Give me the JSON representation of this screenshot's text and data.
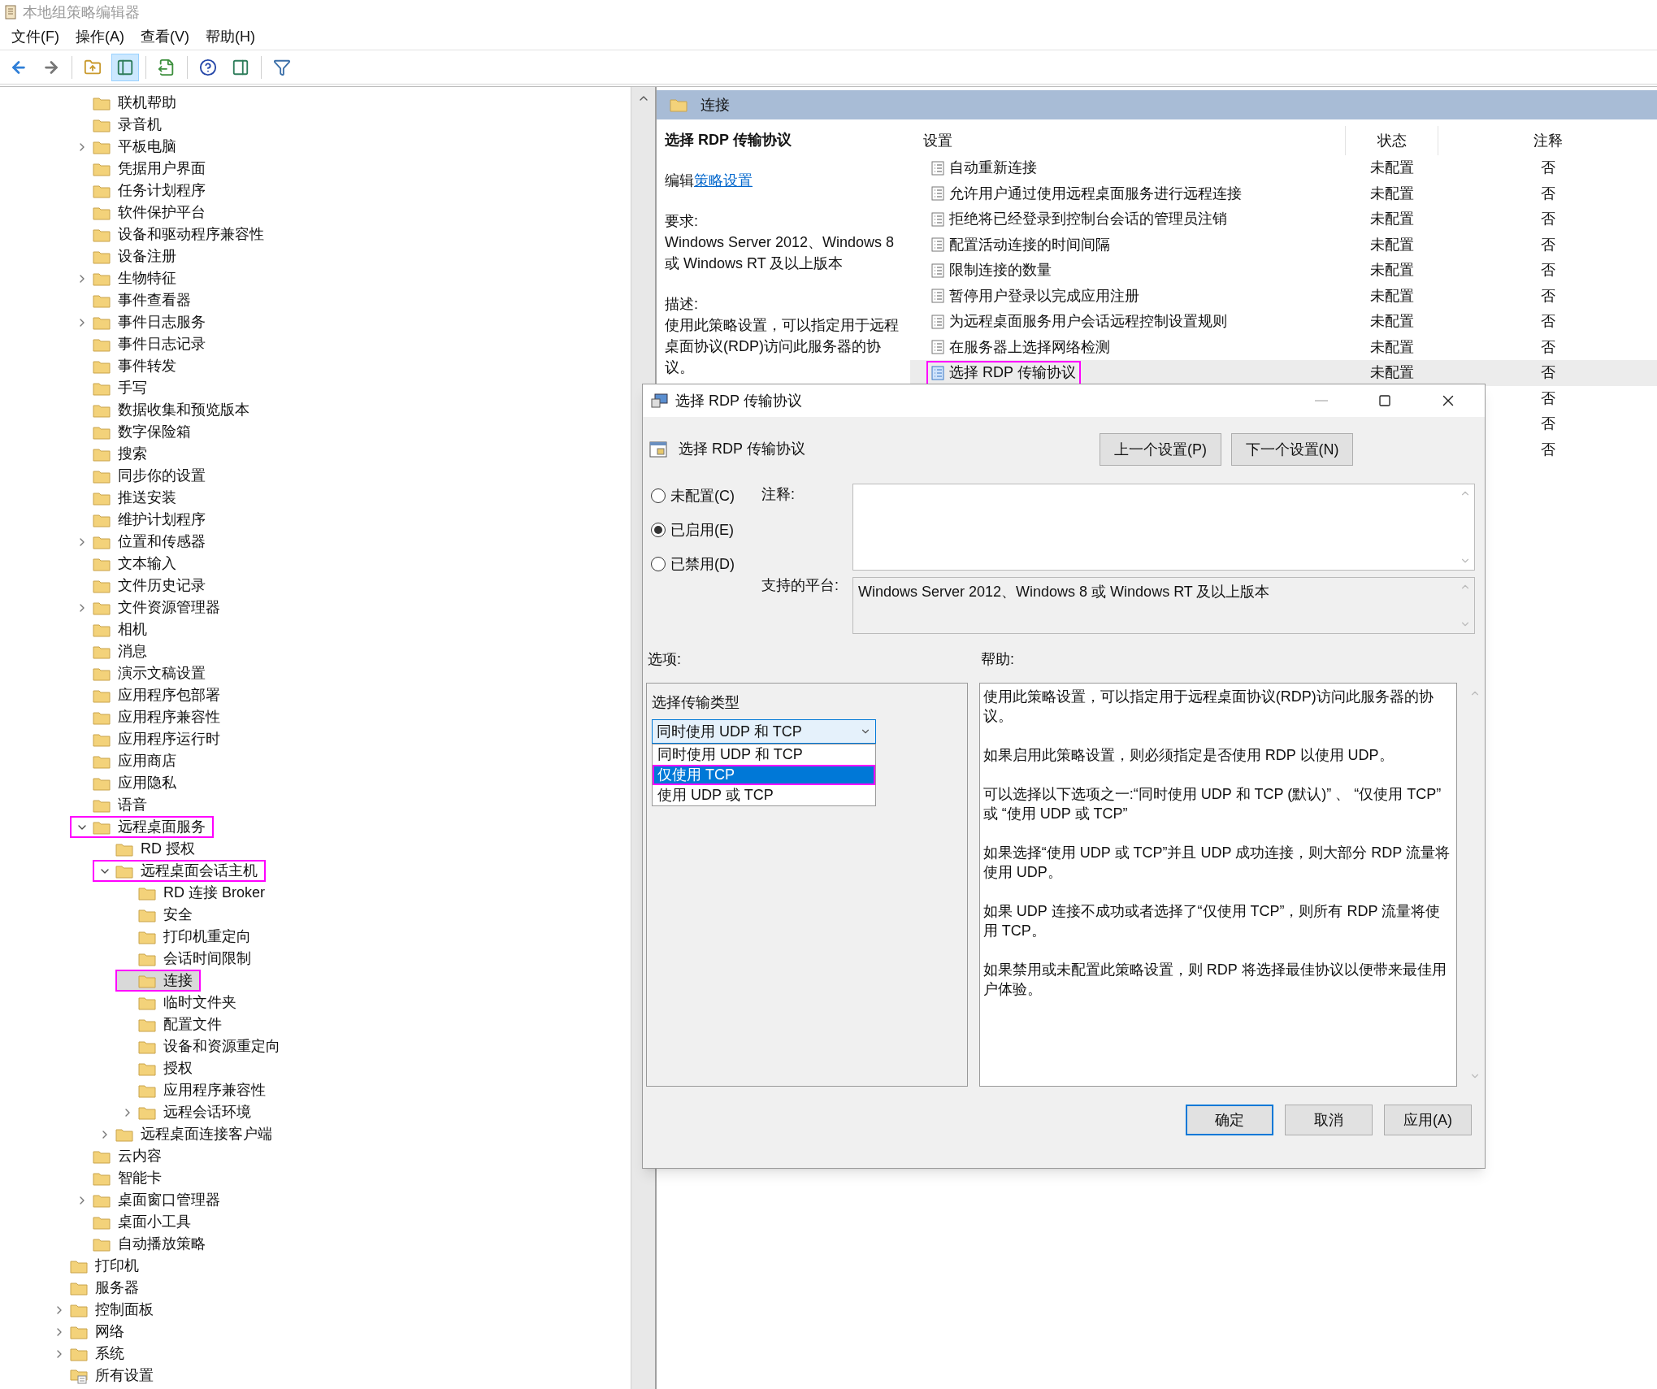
{
  "window": {
    "title": "本地组策略编辑器"
  },
  "menu": [
    "文件(F)",
    "操作(A)",
    "查看(V)",
    "帮助(H)"
  ],
  "toolbar": [
    {
      "kind": "back",
      "pressed": false
    },
    {
      "kind": "forward",
      "pressed": false
    },
    {
      "kind": "up",
      "pressed": false
    },
    {
      "kind": "tree",
      "pressed": true
    },
    {
      "kind": "export",
      "pressed": false
    },
    {
      "kind": "help",
      "pressed": false
    },
    {
      "kind": "actions",
      "pressed": false
    },
    {
      "kind": "filter",
      "pressed": false
    }
  ],
  "tree": {
    "nested_items": [
      {
        "label": "联机帮助",
        "expandable": false,
        "selected": false,
        "annotated": false
      },
      {
        "label": "录音机",
        "expandable": false,
        "selected": false,
        "annotated": false
      },
      {
        "label": "平板电脑",
        "expandable": true,
        "expanded": false,
        "selected": false,
        "annotated": false
      },
      {
        "label": "凭据用户界面",
        "expandable": false,
        "selected": false,
        "annotated": false
      },
      {
        "label": "任务计划程序",
        "expandable": false,
        "selected": false,
        "annotated": false
      },
      {
        "label": "软件保护平台",
        "expandable": false,
        "selected": false,
        "annotated": false
      },
      {
        "label": "设备和驱动程序兼容性",
        "expandable": false,
        "selected": false,
        "annotated": false
      },
      {
        "label": "设备注册",
        "expandable": false,
        "selected": false,
        "annotated": false
      },
      {
        "label": "生物特征",
        "expandable": true,
        "expanded": false,
        "selected": false,
        "annotated": false
      },
      {
        "label": "事件查看器",
        "expandable": false,
        "selected": false,
        "annotated": false
      },
      {
        "label": "事件日志服务",
        "expandable": true,
        "expanded": false,
        "selected": false,
        "annotated": false
      },
      {
        "label": "事件日志记录",
        "expandable": false,
        "selected": false,
        "annotated": false
      },
      {
        "label": "事件转发",
        "expandable": false,
        "selected": false,
        "annotated": false
      },
      {
        "label": "手写",
        "expandable": false,
        "selected": false,
        "annotated": false
      },
      {
        "label": "数据收集和预览版本",
        "expandable": false,
        "selected": false,
        "annotated": false
      },
      {
        "label": "数字保险箱",
        "expandable": false,
        "selected": false,
        "annotated": false
      },
      {
        "label": "搜索",
        "expandable": false,
        "selected": false,
        "annotated": false
      },
      {
        "label": "同步你的设置",
        "expandable": false,
        "selected": false,
        "annotated": false
      },
      {
        "label": "推送安装",
        "expandable": false,
        "selected": false,
        "annotated": false
      },
      {
        "label": "维护计划程序",
        "expandable": false,
        "selected": false,
        "annotated": false
      },
      {
        "label": "位置和传感器",
        "expandable": true,
        "expanded": false,
        "selected": false,
        "annotated": false
      },
      {
        "label": "文本输入",
        "expandable": false,
        "selected": false,
        "annotated": false
      },
      {
        "label": "文件历史记录",
        "expandable": false,
        "selected": false,
        "annotated": false
      },
      {
        "label": "文件资源管理器",
        "expandable": true,
        "expanded": false,
        "selected": false,
        "annotated": false
      },
      {
        "label": "相机",
        "expandable": false,
        "selected": false,
        "annotated": false
      },
      {
        "label": "消息",
        "expandable": false,
        "selected": false,
        "annotated": false
      },
      {
        "label": "演示文稿设置",
        "expandable": false,
        "selected": false,
        "annotated": false
      },
      {
        "label": "应用程序包部署",
        "expandable": false,
        "selected": false,
        "annotated": false
      },
      {
        "label": "应用程序兼容性",
        "expandable": false,
        "selected": false,
        "annotated": false
      },
      {
        "label": "应用程序运行时",
        "expandable": false,
        "selected": false,
        "annotated": false
      },
      {
        "label": "应用商店",
        "expandable": false,
        "selected": false,
        "annotated": false
      },
      {
        "label": "应用隐私",
        "expandable": false,
        "selected": false,
        "annotated": false
      },
      {
        "label": "语音",
        "expandable": false,
        "selected": false,
        "annotated": false
      },
      {
        "label": "远程桌面服务",
        "expandable": true,
        "expanded": true,
        "selected": false,
        "annotated": true,
        "children": [
          {
            "label": "RD 授权",
            "expandable": false,
            "selected": false,
            "annotated": false
          },
          {
            "label": "远程桌面会话主机",
            "expandable": true,
            "expanded": true,
            "selected": false,
            "annotated": true,
            "children": [
              {
                "label": "RD 连接 Broker",
                "expandable": false,
                "selected": false,
                "annotated": false
              },
              {
                "label": "安全",
                "expandable": false,
                "selected": false,
                "annotated": false
              },
              {
                "label": "打印机重定向",
                "expandable": false,
                "selected": false,
                "annotated": false
              },
              {
                "label": "会话时间限制",
                "expandable": false,
                "selected": false,
                "annotated": false
              },
              {
                "label": "连接",
                "expandable": false,
                "selected": true,
                "annotated": true
              },
              {
                "label": "临时文件夹",
                "expandable": false,
                "selected": false,
                "annotated": false
              },
              {
                "label": "配置文件",
                "expandable": false,
                "selected": false,
                "annotated": false
              },
              {
                "label": "设备和资源重定向",
                "expandable": false,
                "selected": false,
                "annotated": false
              },
              {
                "label": "授权",
                "expandable": false,
                "selected": false,
                "annotated": false
              },
              {
                "label": "应用程序兼容性",
                "expandable": false,
                "selected": false,
                "annotated": false
              },
              {
                "label": "远程会话环境",
                "expandable": true,
                "expanded": false,
                "selected": false,
                "annotated": false
              }
            ]
          },
          {
            "label": "远程桌面连接客户端",
            "expandable": true,
            "expanded": false,
            "selected": false,
            "annotated": false
          }
        ]
      },
      {
        "label": "云内容",
        "expandable": false,
        "selected": false,
        "annotated": false
      },
      {
        "label": "智能卡",
        "expandable": false,
        "selected": false,
        "annotated": false
      },
      {
        "label": "桌面窗口管理器",
        "expandable": true,
        "expanded": false,
        "selected": false,
        "annotated": false
      },
      {
        "label": "桌面小工具",
        "expandable": false,
        "selected": false,
        "annotated": false
      },
      {
        "label": "自动播放策略",
        "expandable": false,
        "selected": false,
        "annotated": false
      }
    ],
    "items": [
      {
        "label": "打印机",
        "expandable": false,
        "selected": false,
        "annotated": false,
        "kind": "folder"
      },
      {
        "label": "服务器",
        "expandable": false,
        "selected": false,
        "annotated": false,
        "kind": "folder"
      },
      {
        "label": "控制面板",
        "expandable": true,
        "expanded": false,
        "selected": false,
        "annotated": false,
        "kind": "folder"
      },
      {
        "label": "网络",
        "expandable": true,
        "expanded": false,
        "selected": false,
        "annotated": false,
        "kind": "folder"
      },
      {
        "label": "系统",
        "expandable": true,
        "expanded": false,
        "selected": false,
        "annotated": false,
        "kind": "folder"
      },
      {
        "label": "所有设置",
        "expandable": false,
        "selected": false,
        "annotated": false,
        "kind": "settings"
      }
    ]
  },
  "details": {
    "header": "连接",
    "description": {
      "title": "选择 RDP 传输协议",
      "edit_prefix": "编辑",
      "edit_link": "策略设置",
      "requirements_label": "要求:",
      "requirements": "Windows Server 2012、Windows 8 或 Windows RT 及以上版本",
      "description_label": "描述:",
      "description": "使用此策略设置，可以指定用于远程桌面协议(RDP)访问此服务器的协议。"
    },
    "table": {
      "columns": [
        "设置",
        "状态",
        "注释"
      ],
      "rows": [
        {
          "setting": "自动重新连接",
          "state": "未配置",
          "comment": "否",
          "selected": false,
          "annotated": false
        },
        {
          "setting": "允许用户通过使用远程桌面服务进行远程连接",
          "state": "未配置",
          "comment": "否",
          "selected": false,
          "annotated": false
        },
        {
          "setting": "拒绝将已经登录到控制台会话的管理员注销",
          "state": "未配置",
          "comment": "否",
          "selected": false,
          "annotated": false
        },
        {
          "setting": "配置活动连接的时间间隔",
          "state": "未配置",
          "comment": "否",
          "selected": false,
          "annotated": false
        },
        {
          "setting": "限制连接的数量",
          "state": "未配置",
          "comment": "否",
          "selected": false,
          "annotated": false
        },
        {
          "setting": "暂停用户登录以完成应用注册",
          "state": "未配置",
          "comment": "否",
          "selected": false,
          "annotated": false
        },
        {
          "setting": "为远程桌面服务用户会话远程控制设置规则",
          "state": "未配置",
          "comment": "否",
          "selected": false,
          "annotated": false
        },
        {
          "setting": "在服务器上选择网络检测",
          "state": "未配置",
          "comment": "否",
          "selected": false,
          "annotated": false
        },
        {
          "setting": "选择 RDP 传输协议",
          "state": "未配置",
          "comment": "否",
          "selected": true,
          "annotated": true
        },
        {
          "comment": "否",
          "selected": false
        },
        {
          "comment": "否",
          "selected": false
        },
        {
          "comment": "否",
          "selected": false
        }
      ]
    }
  },
  "dialog": {
    "title": "选择 RDP 传输协议",
    "heading": "选择 RDP 传输协议",
    "nav_buttons": [
      "上一个设置(P)",
      "下一个设置(N)"
    ],
    "radios": [
      {
        "label": "未配置(C)",
        "selected": false
      },
      {
        "label": "已启用(E)",
        "selected": true
      },
      {
        "label": "已禁用(D)",
        "selected": false
      }
    ],
    "comment_label": "注释:",
    "platform_label": "支持的平台:",
    "platform": "Windows Server 2012、Windows 8 或 Windows RT 及以上版本",
    "options_label": "选项:",
    "help_label": "帮助:",
    "options": {
      "label": "选择传输类型",
      "combo_value": "同时使用 UDP 和 TCP",
      "dropdown": [
        {
          "label": "同时使用 UDP 和 TCP",
          "selected": false,
          "annotated": false
        },
        {
          "label": "仅使用 TCP",
          "selected": true,
          "annotated": true
        },
        {
          "label": "使用 UDP 或 TCP",
          "selected": false,
          "annotated": false
        }
      ]
    },
    "help": [
      "使用此策略设置，可以指定用于远程桌面协议(RDP)访问此服务器的协议。",
      "如果启用此策略设置，则必须指定是否使用 RDP 以使用 UDP。",
      "可以选择以下选项之一:“同时使用 UDP 和 TCP (默认)” 、 “仅使用 TCP” 或 “使用 UDP 或 TCP”",
      "如果选择“使用 UDP 或 TCP”并且 UDP 成功连接，则大部分 RDP 流量将使用 UDP。",
      "如果 UDP 连接不成功或者选择了“仅使用 TCP”，则所有 RDP 流量将使用 TCP。",
      "如果禁用或未配置此策略设置，则 RDP 将选择最佳协议以便带来最佳用户体验。"
    ],
    "buttons": [
      {
        "label": "确定",
        "default": true
      },
      {
        "label": "取消",
        "default": false
      },
      {
        "label": "应用(A)",
        "default": false
      }
    ]
  }
}
